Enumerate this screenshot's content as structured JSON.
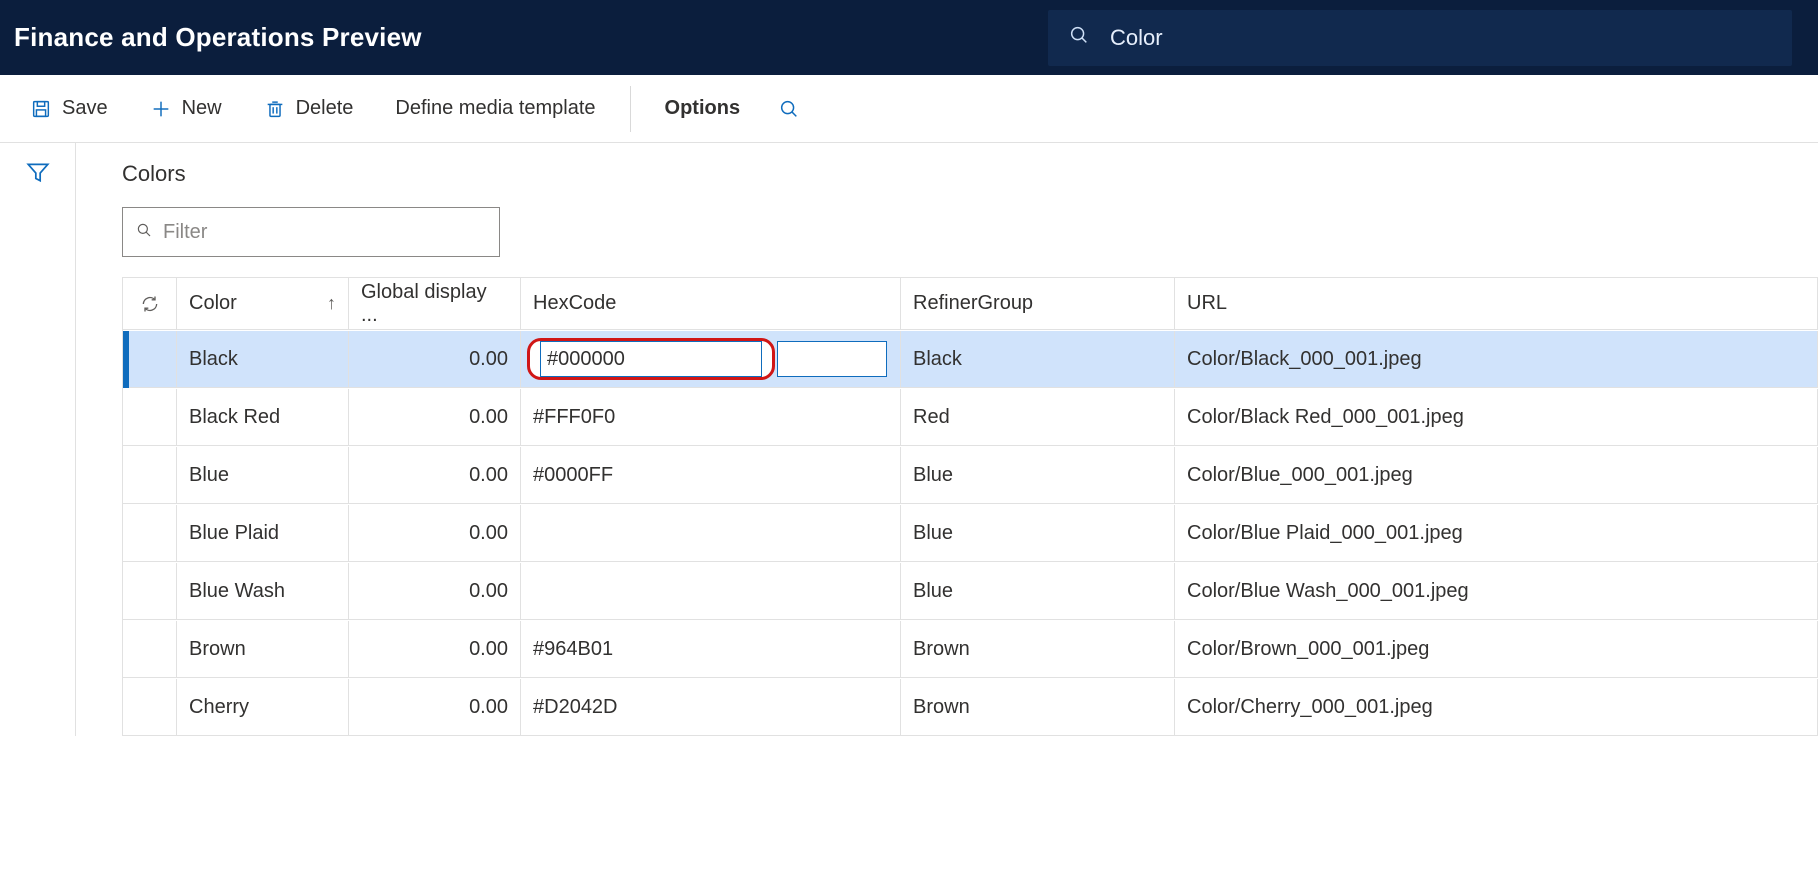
{
  "header": {
    "app_title": "Finance and Operations Preview",
    "search_value": "Color"
  },
  "toolbar": {
    "save": "Save",
    "new": "New",
    "delete": "Delete",
    "define_media_template": "Define media template",
    "options": "Options"
  },
  "page": {
    "title": "Colors",
    "filter_placeholder": "Filter"
  },
  "grid": {
    "columns": {
      "color": "Color",
      "global_display": "Global display ...",
      "hexcode": "HexCode",
      "refiner_group": "RefinerGroup",
      "url": "URL"
    },
    "rows": [
      {
        "color": "Black",
        "gd": "0.00",
        "hex": "#000000",
        "rg": "Black",
        "url": "Color/Black_000_001.jpeg",
        "selected": true,
        "editing": true
      },
      {
        "color": "Black Red",
        "gd": "0.00",
        "hex": "#FFF0F0",
        "rg": "Red",
        "url": "Color/Black Red_000_001.jpeg"
      },
      {
        "color": "Blue",
        "gd": "0.00",
        "hex": "#0000FF",
        "rg": "Blue",
        "url": "Color/Blue_000_001.jpeg"
      },
      {
        "color": "Blue Plaid",
        "gd": "0.00",
        "hex": "",
        "rg": "Blue",
        "url": "Color/Blue Plaid_000_001.jpeg"
      },
      {
        "color": "Blue Wash",
        "gd": "0.00",
        "hex": "",
        "rg": "Blue",
        "url": "Color/Blue Wash_000_001.jpeg"
      },
      {
        "color": "Brown",
        "gd": "0.00",
        "hex": "#964B01",
        "rg": "Brown",
        "url": "Color/Brown_000_001.jpeg"
      },
      {
        "color": "Cherry",
        "gd": "0.00",
        "hex": "#D2042D",
        "rg": "Brown",
        "url": "Color/Cherry_000_001.jpeg"
      }
    ]
  }
}
